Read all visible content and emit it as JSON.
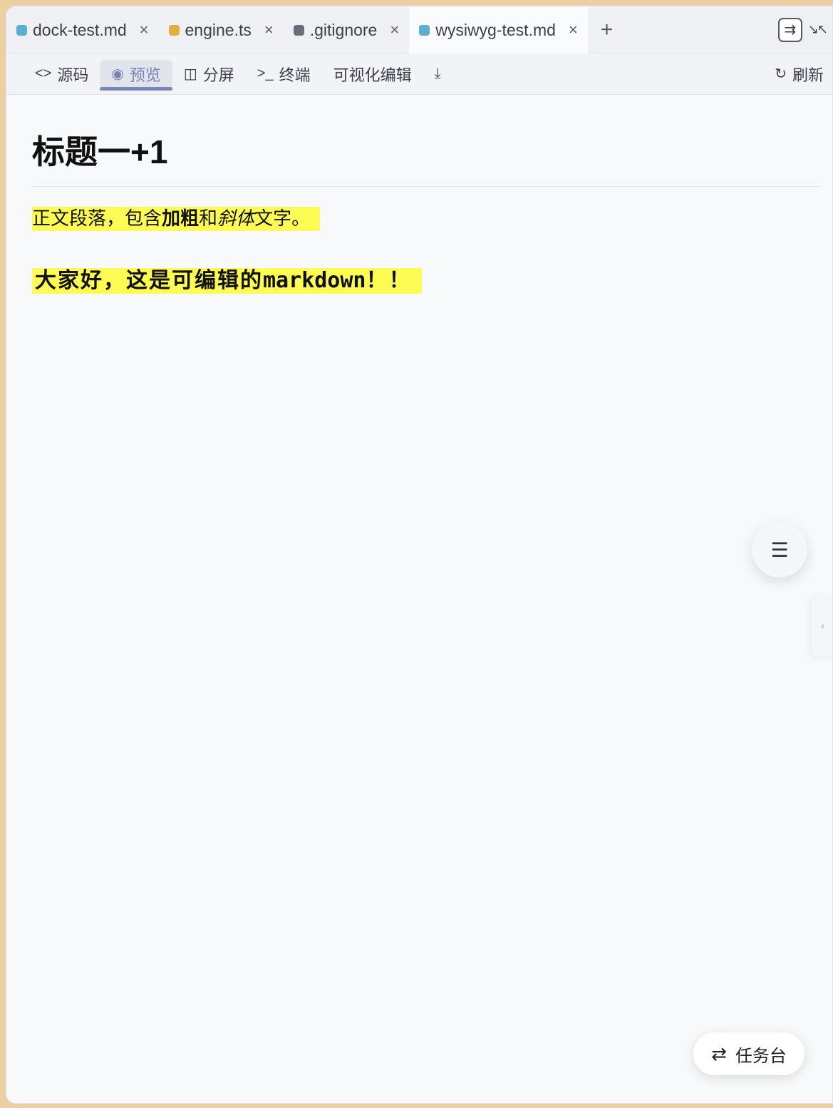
{
  "tabs": [
    {
      "label": "dock-test.md",
      "color": "#5aaed0",
      "close": "×"
    },
    {
      "label": "engine.ts",
      "color": "#e0b040",
      "close": "×"
    },
    {
      "label": ".gitignore",
      "color": "#6a6e7a",
      "close": "×"
    },
    {
      "label": "wysiwyg-test.md",
      "color": "#5aaed0",
      "close": "×",
      "active": true
    }
  ],
  "new_tab_icon": "+",
  "toolbar": {
    "source": {
      "icon": "<>",
      "label": "源码"
    },
    "preview": {
      "icon": "◉",
      "label": "预览"
    },
    "split": {
      "icon": "◫",
      "label": "分屏"
    },
    "terminal": {
      "icon": ">_",
      "label": "终端"
    },
    "visual_edit": {
      "label": "可视化编辑"
    },
    "download_icon": "⤓",
    "refresh": {
      "icon": "↻",
      "label": "刷新"
    }
  },
  "document": {
    "heading": "标题一+1",
    "para_start": "正文段落，包含",
    "para_bold": "加粗",
    "para_mid": "和",
    "para_italic": "斜体",
    "para_end": "文字。",
    "big_cjk": "大家好，这是可编辑的",
    "big_latin": "markdown",
    "big_end": "！！"
  },
  "toc_icon": "☰",
  "side_handle_icon": "‹",
  "task_button": {
    "icon": "⇄",
    "label": "任务台"
  }
}
